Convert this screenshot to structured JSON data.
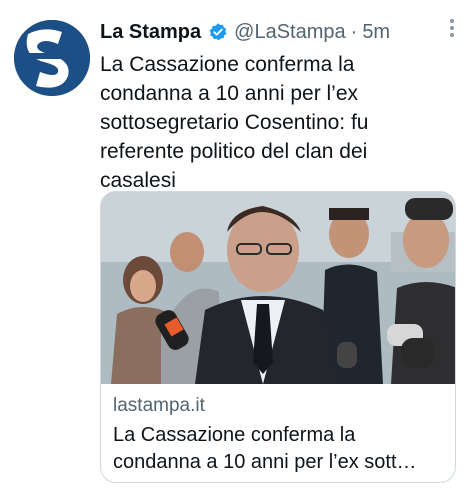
{
  "tweet": {
    "author_name": "La Stampa",
    "author_handle": "@LaStampa",
    "separator": "·",
    "timestamp": "5m",
    "text": "La Cassazione conferma la condanna a 10 anni per l’ex sottosegretario Cosentino: fu referente politico del clan dei casalesi"
  },
  "card": {
    "domain": "lastampa.it",
    "title": "La Cassazione conferma la condanna a 10 anni per l’ex sott…"
  },
  "icons": {
    "avatar": "la-stampa-logo",
    "verified": "verified-badge-icon",
    "more": "more-options-icon"
  },
  "colors": {
    "brand": "#1c4f86",
    "verified": "#1d9bf0",
    "secondary_text": "#536471"
  }
}
